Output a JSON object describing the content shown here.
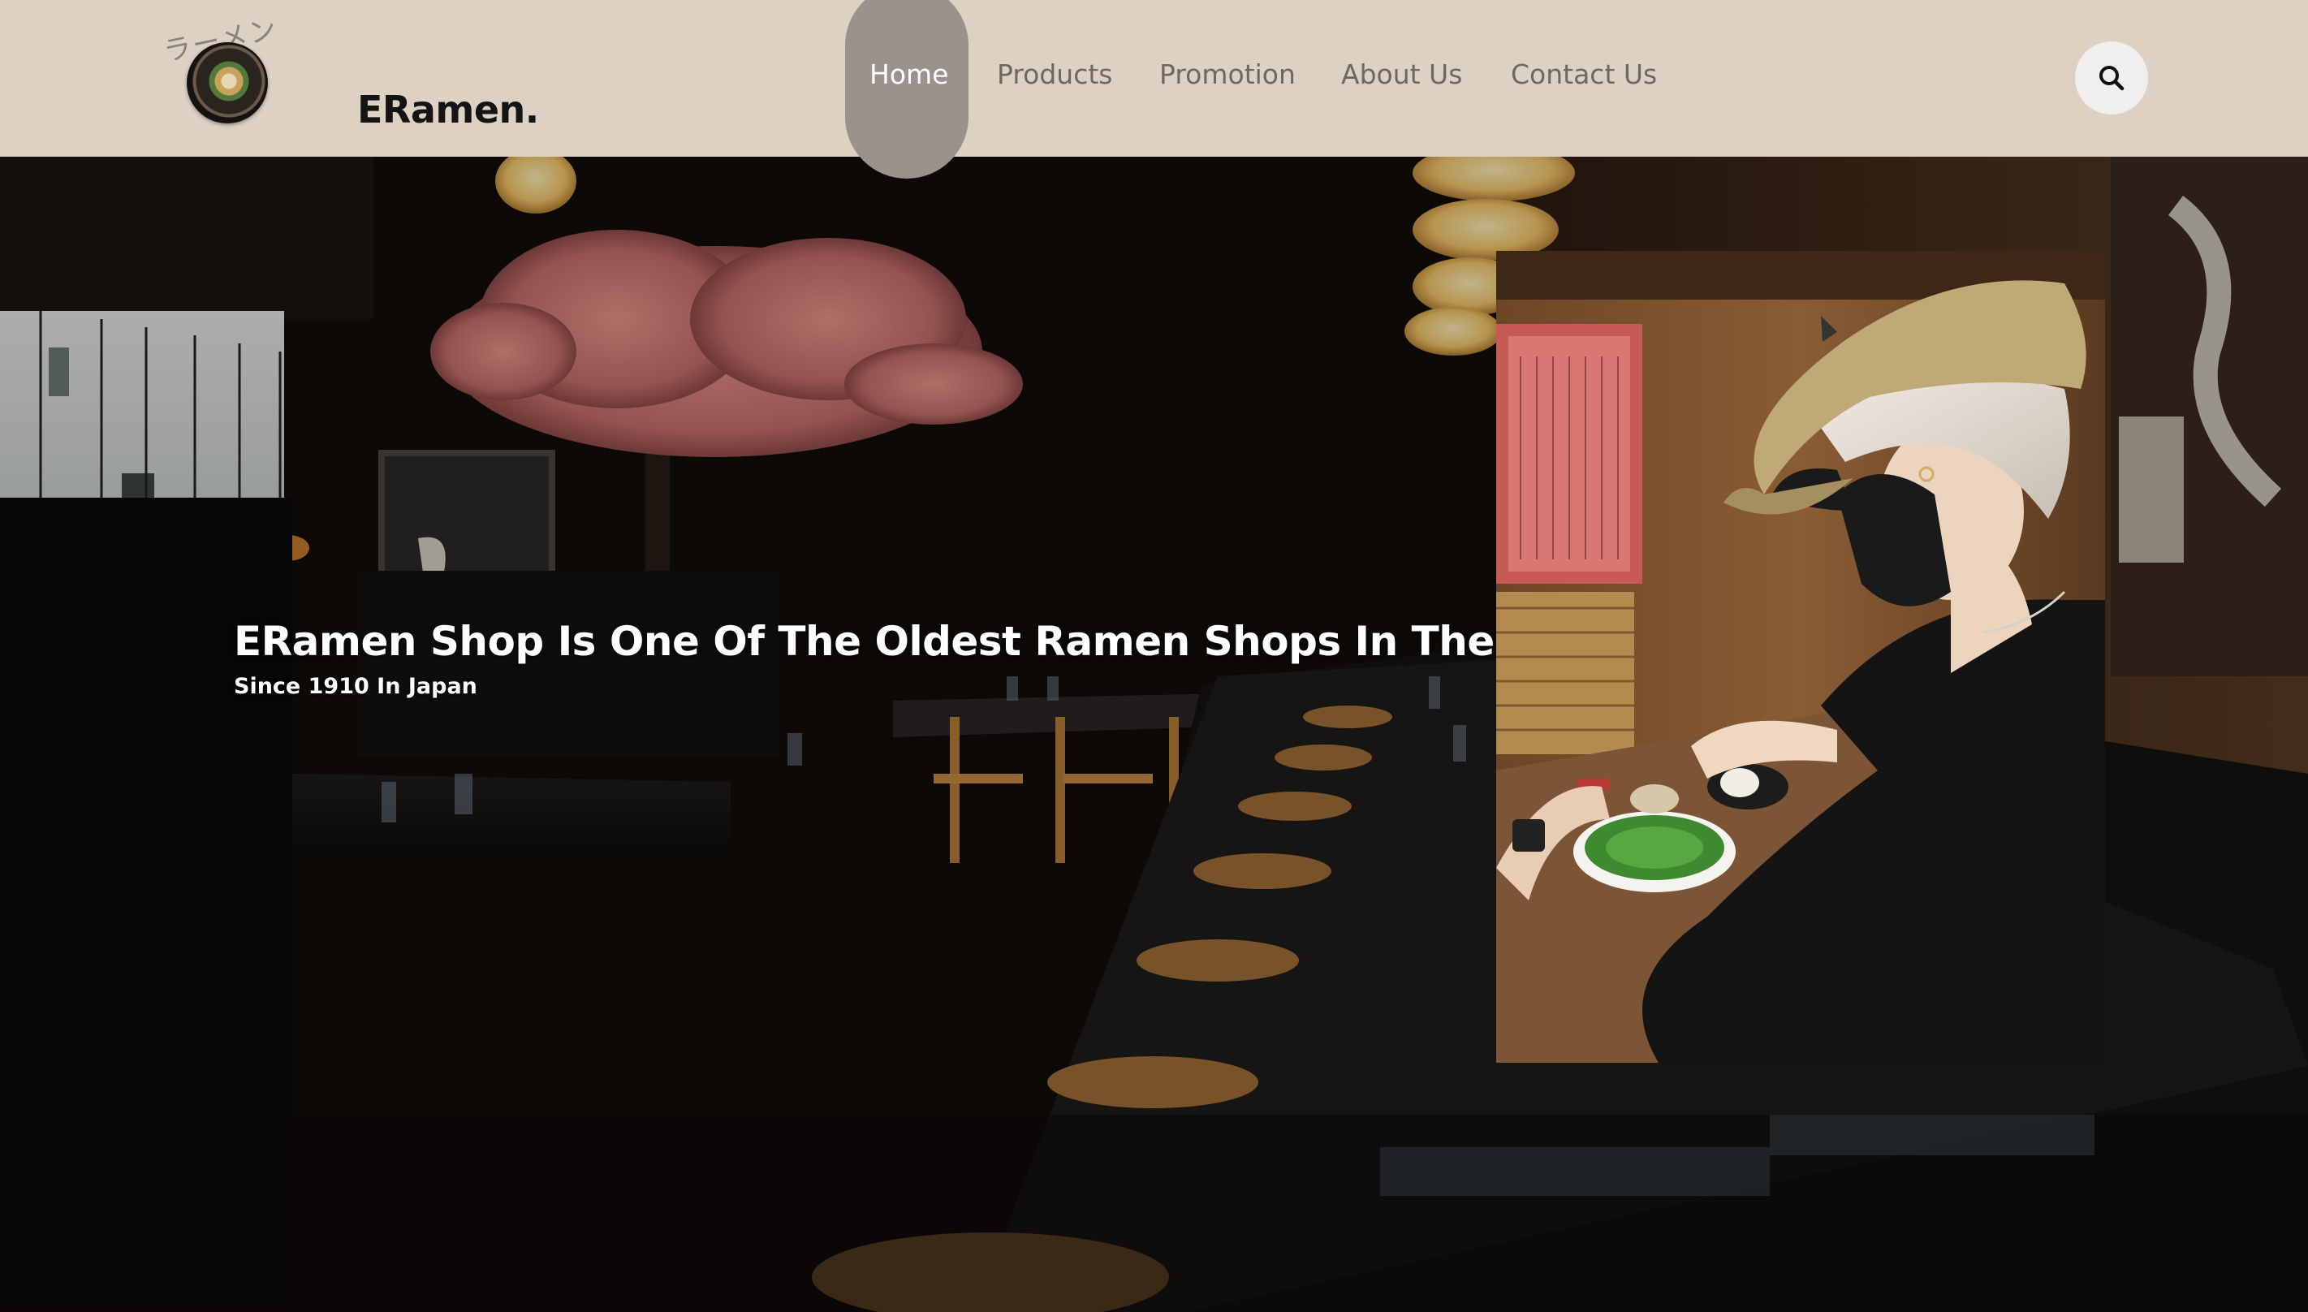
{
  "header": {
    "logo_text": "ラーメン",
    "brand": "ERamen.",
    "nav": [
      {
        "label": "Home",
        "active": true
      },
      {
        "label": "Products",
        "active": false
      },
      {
        "label": "Promotion",
        "active": false
      },
      {
        "label": "About Us",
        "active": false
      },
      {
        "label": "Contact Us",
        "active": false
      }
    ],
    "search_icon": "search-icon"
  },
  "hero": {
    "title": "ERamen Shop Is One Of The Oldest Ramen Shops In The World.",
    "subtitle": "Since 1910 In Japan",
    "background_image": "restaurant-interior",
    "side_image": "customer-eating-ramen"
  },
  "colors": {
    "header_bg": "#dcd1c3",
    "nav_active_bg": "#9a938c",
    "nav_text": "#6e6862",
    "search_bg": "#f1efed"
  }
}
